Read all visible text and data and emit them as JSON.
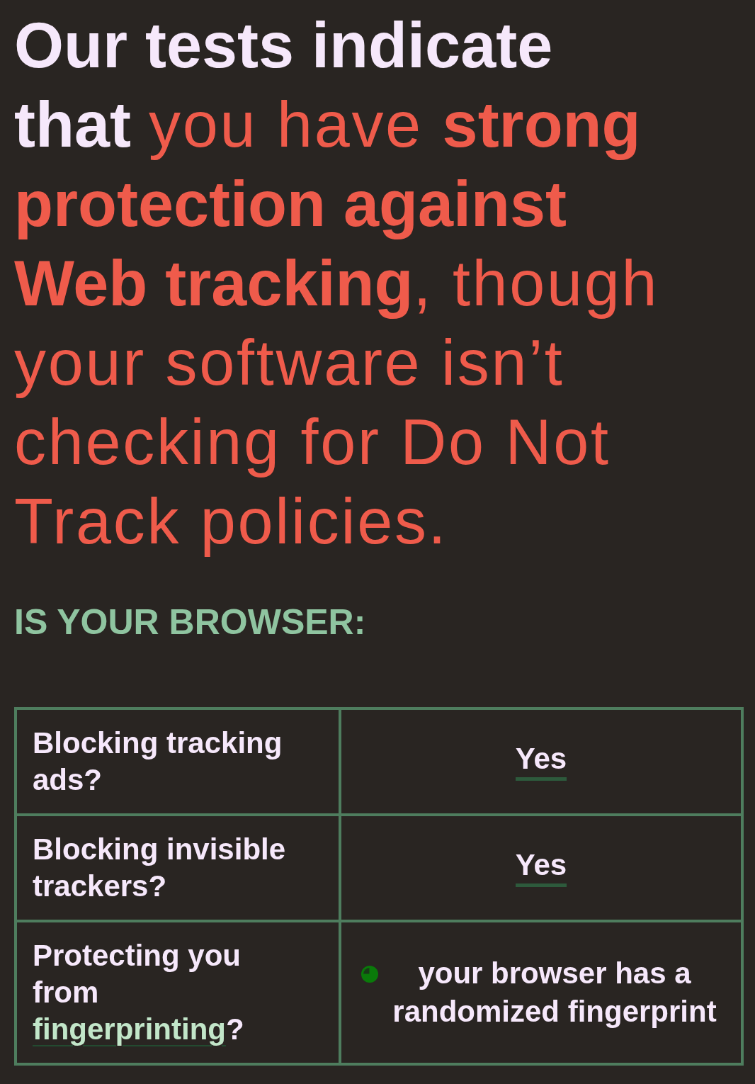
{
  "headline": {
    "lead": "Our tests indicate that",
    "verdict": "you have **strong protection against Web tracking**, though your software isn’t checking for Do Not Track policies."
  },
  "section_title": "IS YOUR BROWSER:",
  "results": [
    {
      "question": "Blocking tracking ads?",
      "answer": "Yes",
      "kind": "yes"
    },
    {
      "question": "Blocking invisible trackers?",
      "answer": "Yes",
      "kind": "yes"
    },
    {
      "question": "Protecting you from",
      "question_link": "fingerprinting",
      "question_suffix": "?",
      "answer": "your browser has a randomized fingerprint",
      "kind": "status"
    }
  ]
}
